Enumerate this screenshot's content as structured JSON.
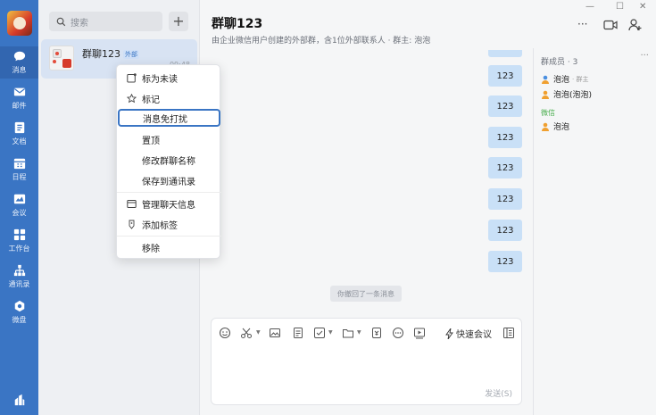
{
  "rail": {
    "items": [
      {
        "label": "消息",
        "icon": "chat-bubble-icon"
      },
      {
        "label": "邮件",
        "icon": "mail-icon"
      },
      {
        "label": "文档",
        "icon": "document-icon"
      },
      {
        "label": "日程",
        "icon": "calendar-icon"
      },
      {
        "label": "会议",
        "icon": "meeting-icon"
      },
      {
        "label": "工作台",
        "icon": "workbench-icon"
      },
      {
        "label": "通讯录",
        "icon": "contacts-icon"
      },
      {
        "label": "微盘",
        "icon": "drive-icon"
      }
    ]
  },
  "search": {
    "placeholder": "搜索"
  },
  "conversation": {
    "name": "群聊123",
    "badge": "外部",
    "time": "09:48"
  },
  "chat": {
    "title": "群聊123",
    "subtitle": "由企业微信用户创建的外部群，含1位外部联系人 · 群主: 泡泡",
    "messages": [
      "123",
      "123",
      "123",
      "123",
      "123",
      "123",
      "123"
    ],
    "recall_notice": "你撤回了一条消息",
    "toolbar_meeting": "快速会议",
    "send_label": "发送(S)"
  },
  "members": {
    "title": "群成员 · 3",
    "more": "···",
    "list": [
      {
        "name": "泡泡",
        "tag": "· 群主"
      },
      {
        "name": "泡泡(泡泡)",
        "tag": ""
      }
    ],
    "section_wechat": "微信",
    "wechat_list": [
      {
        "name": "泡泡"
      }
    ]
  },
  "menu": {
    "items": [
      {
        "label": "标为未读",
        "icon": "mark-unread-icon"
      },
      {
        "label": "标记",
        "icon": "star-icon"
      },
      {
        "label": "消息免打扰",
        "icon": ""
      },
      {
        "label": "置顶",
        "icon": ""
      },
      {
        "label": "修改群聊名称",
        "icon": ""
      },
      {
        "label": "保存到通讯录",
        "icon": ""
      },
      {
        "label": "管理聊天信息",
        "icon": "window-icon"
      },
      {
        "label": "添加标签",
        "icon": "tag-icon"
      },
      {
        "label": "移除",
        "icon": ""
      }
    ]
  },
  "window": {
    "more": "···"
  },
  "colors": {
    "rail": "#3a75c4",
    "bubble": "#c9e0f7",
    "accent": "#3a75c4"
  }
}
